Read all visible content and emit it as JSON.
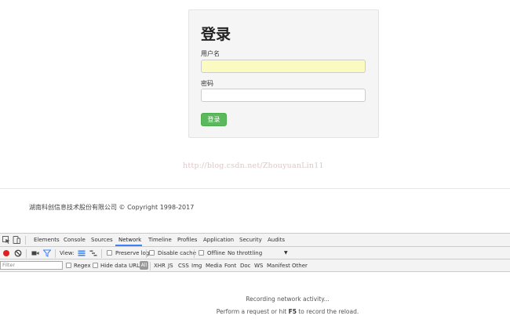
{
  "login": {
    "title": "登录",
    "username_label": "用户名",
    "username_value": "",
    "password_label": "密码",
    "password_value": "",
    "submit_label": "登录"
  },
  "watermark": "http://blog.csdn.net/ZhouyuanLin11",
  "footer": "湖南科创信息技术股份有限公司 © Copyright 1998-2017",
  "devtools": {
    "tabs": [
      "Elements",
      "Console",
      "Sources",
      "Network",
      "Timeline",
      "Profiles",
      "Application",
      "Security",
      "Audits"
    ],
    "active_tab": "Network",
    "toolbar": {
      "view_label": "View:",
      "preserve_log": "Preserve log",
      "disable_cache": "Disable cache",
      "offline": "Offline",
      "throttling": "No throttling"
    },
    "filter": {
      "placeholder": "Filter",
      "regex": "Regex",
      "hide_data_urls": "Hide data URLs",
      "types": [
        "All",
        "XHR",
        "JS",
        "CSS",
        "Img",
        "Media",
        "Font",
        "Doc",
        "WS",
        "Manifest",
        "Other"
      ]
    },
    "message": {
      "line1": "Recording network activity...",
      "line2_prefix": "Perform a request or hit ",
      "line2_key": "F5",
      "line2_suffix": " to record the reload."
    }
  },
  "colors": {
    "accent_tab": "#3e82f7",
    "login_button": "#5cb85c",
    "record": "#e02020",
    "autofill": "#fbfbc1"
  }
}
